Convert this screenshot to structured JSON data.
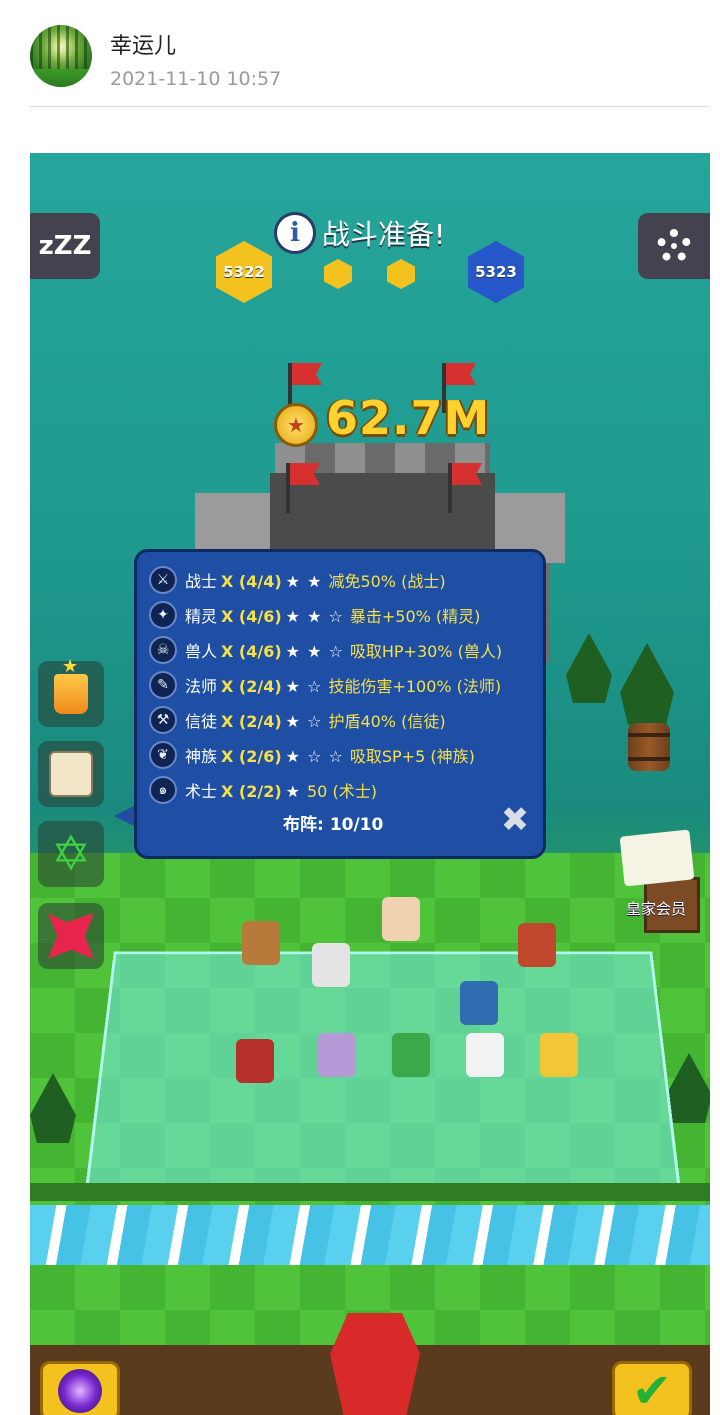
{
  "post": {
    "username": "幸运儿",
    "timestamp": "2021-11-10 10:57"
  },
  "game": {
    "title": "战斗准备!",
    "info_icon": "i",
    "sleep_icon": "zZZ",
    "player_score": "5322",
    "enemy_score": "5323",
    "coins": "62.7M",
    "royal_label": "皇家会员",
    "buffs": [
      {
        "icon": "sword-icon",
        "glyph": "⚔",
        "name": "战士",
        "count": "X (4/4)",
        "stars": "★ ★",
        "effect": "减免50% (战士)"
      },
      {
        "icon": "elf-icon",
        "glyph": "✦",
        "name": "精灵",
        "count": "X (4/6)",
        "stars": "★ ★ ☆",
        "effect": "暴击+50% (精灵)"
      },
      {
        "icon": "orc-icon",
        "glyph": "☠",
        "name": "兽人",
        "count": "X (4/6)",
        "stars": "★ ★ ☆",
        "effect": "吸取HP+30% (兽人)"
      },
      {
        "icon": "staff-icon",
        "glyph": "✎",
        "name": "法师",
        "count": "X (2/4)",
        "stars": "★ ☆",
        "effect": "技能伤害+100% (法师)"
      },
      {
        "icon": "hammer-icon",
        "glyph": "⚒",
        "name": "信徒",
        "count": "X (2/4)",
        "stars": "★ ☆",
        "effect": "护盾40% (信徒)"
      },
      {
        "icon": "wings-icon",
        "glyph": "❦",
        "name": "神族",
        "count": "X (2/6)",
        "stars": "★ ☆ ☆",
        "effect": "吸取SP+5 (神族)"
      },
      {
        "icon": "spirit-icon",
        "glyph": "๑",
        "name": "术士",
        "count": "X (2/2)",
        "stars": "★",
        "effect": "50 (术士)"
      }
    ],
    "formation_label": "布阵:",
    "formation_value": "10/10",
    "close_glyph": "✖",
    "confirm_glyph": "✔"
  }
}
